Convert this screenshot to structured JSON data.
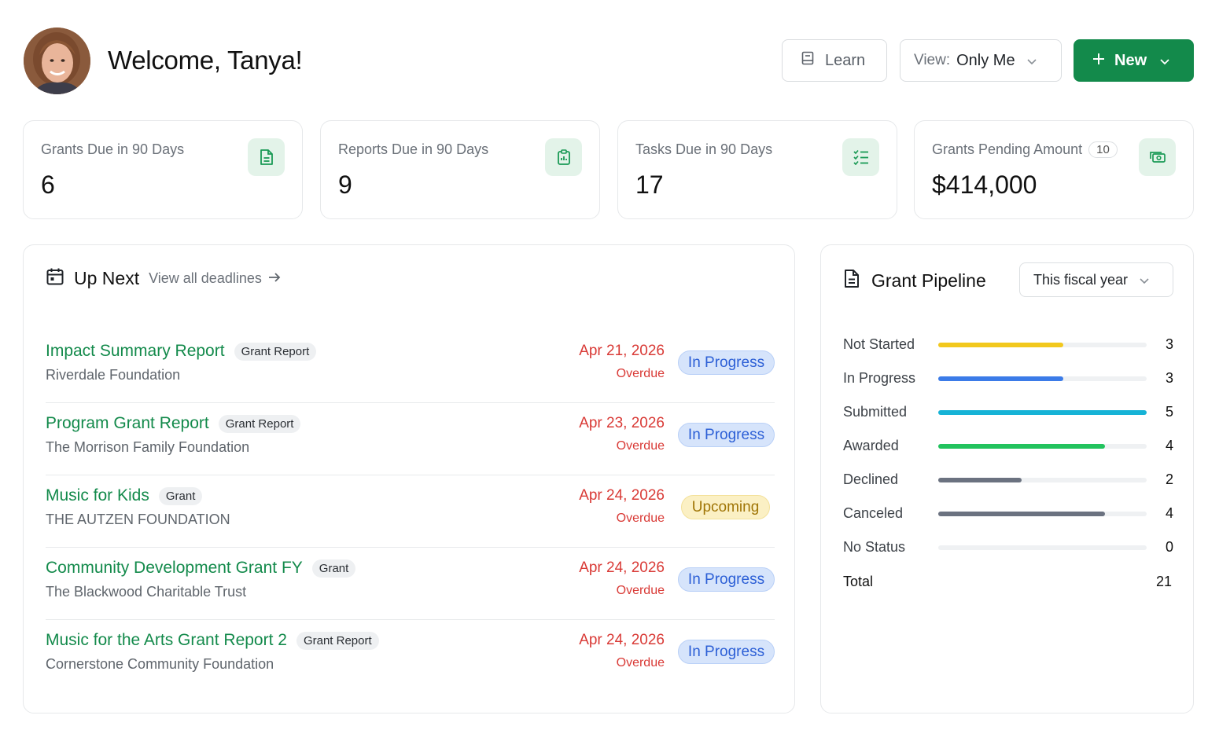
{
  "header": {
    "greeting": "Welcome, Tanya!",
    "learn_label": "Learn",
    "view_label": "View:",
    "view_value": "Only Me",
    "new_label": "New"
  },
  "stats": [
    {
      "label": "Grants Due in 90 Days",
      "value": "6",
      "icon": "document-icon"
    },
    {
      "label": "Reports Due in 90 Days",
      "value": "9",
      "icon": "clipboard-icon"
    },
    {
      "label": "Tasks Due in 90 Days",
      "value": "17",
      "icon": "checklist-icon"
    },
    {
      "label": "Grants Pending Amount",
      "badge": "10",
      "value": "$414,000",
      "icon": "money-icon"
    }
  ],
  "up_next": {
    "title": "Up Next",
    "view_all": "View all deadlines",
    "items": [
      {
        "title": "Impact Summary Report",
        "type": "Grant Report",
        "org": "Riverdale Foundation",
        "date": "Apr 21, 2026",
        "due_status": "Overdue",
        "status": "In Progress"
      },
      {
        "title": "Program Grant Report",
        "type": "Grant Report",
        "org": "The Morrison Family Foundation",
        "date": "Apr 23, 2026",
        "due_status": "Overdue",
        "status": "In Progress"
      },
      {
        "title": "Music for Kids",
        "type": "Grant",
        "org": "THE AUTZEN FOUNDATION",
        "date": "Apr 24, 2026",
        "due_status": "Overdue",
        "status": "Upcoming"
      },
      {
        "title": "Community Development Grant FY",
        "type": "Grant",
        "org": "The Blackwood Charitable Trust",
        "date": "Apr 24, 2026",
        "due_status": "Overdue",
        "status": "In Progress"
      },
      {
        "title": "Music for the Arts Grant Report 2",
        "type": "Grant Report",
        "org": "Cornerstone Community Foundation",
        "date": "Apr 24, 2026",
        "due_status": "Overdue",
        "status": "In Progress"
      }
    ]
  },
  "pipeline": {
    "title": "Grant Pipeline",
    "period": "This fiscal year",
    "max": 5,
    "rows": [
      {
        "label": "Not Started",
        "value": "3",
        "color": "#f2c81d"
      },
      {
        "label": "In Progress",
        "value": "3",
        "color": "#3b7be8"
      },
      {
        "label": "Submitted",
        "value": "5",
        "color": "#16b3d6"
      },
      {
        "label": "Awarded",
        "value": "4",
        "color": "#22c35e"
      },
      {
        "label": "Declined",
        "value": "2",
        "color": "#6b7280"
      },
      {
        "label": "Canceled",
        "value": "4",
        "color": "#6b7280"
      },
      {
        "label": "No Status",
        "value": "0",
        "color": "#6b7280"
      }
    ],
    "total_label": "Total",
    "total_value": "21"
  }
}
